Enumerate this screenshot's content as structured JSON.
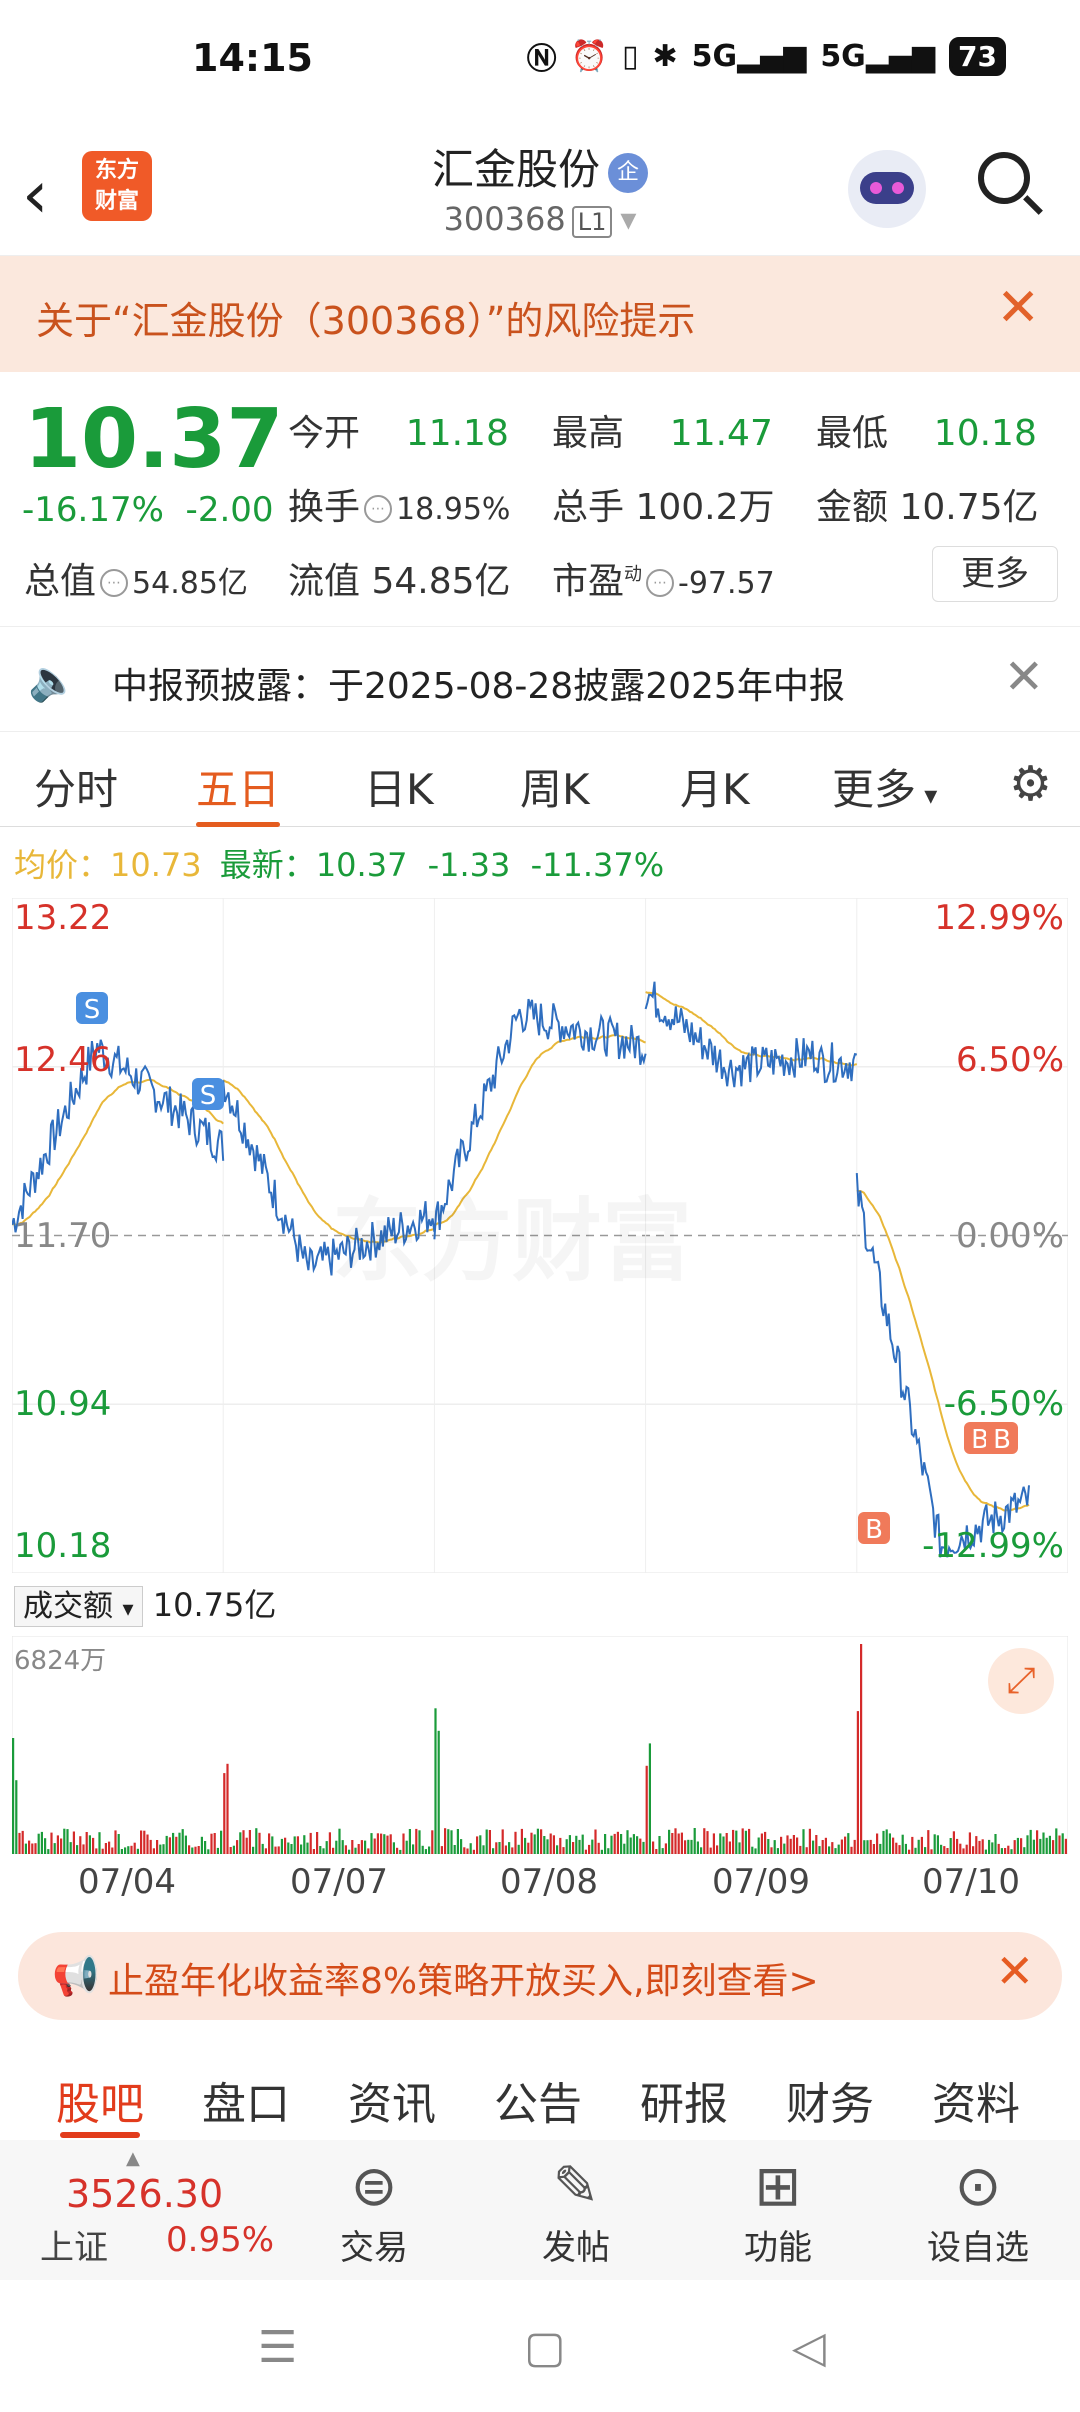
{
  "status_bar": {
    "time": "14:15",
    "network": "5G",
    "battery": "73"
  },
  "header": {
    "stock_name": "汇金股份",
    "stock_code": "300368",
    "level_badge": "L1",
    "qualified_badge": "企",
    "logo_line1": "东方",
    "logo_line2": "财富"
  },
  "risk_banner": {
    "text": "关于“汇金股份（300368）”的风险提示"
  },
  "quote": {
    "price": "10.37",
    "change_pct": "-16.17%",
    "change": "-2.00",
    "open_label": "今开",
    "open": "11.18",
    "high_label": "最高",
    "high": "11.47",
    "low_label": "最低",
    "low": "10.18",
    "turnover_label": "换手",
    "turnover": "18.95%",
    "volume_label": "总手",
    "volume": "100.2万",
    "amount_label": "金额",
    "amount": "10.75亿",
    "total_cap_label": "总值",
    "total_cap": "54.85亿",
    "float_cap_label": "流值",
    "float_cap": "54.85亿",
    "pe_label": "市盈",
    "pe_super": "动",
    "pe": "-97.57",
    "more_label": "更多"
  },
  "notice": {
    "text": "中报预披露：于2025-08-28披露2025年中报"
  },
  "chart_tabs": [
    "分时",
    "五日",
    "日K",
    "周K",
    "月K",
    "更多"
  ],
  "active_tab": "五日",
  "avg_line": {
    "avg_label": "均价：",
    "avg": "10.73",
    "latest_label": "最新：",
    "latest": "10.37",
    "latest_change": "-1.33",
    "latest_pct": "-11.37%"
  },
  "chart_data": {
    "type": "line",
    "y_labels_left": [
      "13.22",
      "12.46",
      "11.70",
      "10.94",
      "10.18"
    ],
    "y_labels_right": [
      "12.99%",
      "6.50%",
      "0.00%",
      "-6.50%",
      "-12.99%"
    ],
    "ylim": [
      10.18,
      13.22
    ],
    "x_labels": [
      "07/04",
      "07/07",
      "07/08",
      "07/09",
      "07/10"
    ],
    "volume_axis_max": "6824万",
    "volume_label": "成交额",
    "volume_value": "10.75亿",
    "markers": [
      "S",
      "S",
      "B",
      "B",
      "B"
    ],
    "watermark": "东方财富",
    "colors": {
      "price": "#2f6ebf",
      "avg": "#e8b739",
      "up": "#d42a2a",
      "down": "#1a9b3a"
    }
  },
  "promo": {
    "text": "止盈年化收益率8%策略开放买入,即刻查看>"
  },
  "bottom_tabs": [
    "股吧",
    "盘口",
    "资讯",
    "公告",
    "研报",
    "财务",
    "资料"
  ],
  "footer": {
    "index_value": "3526.30",
    "index_name": "上证",
    "index_pct": "0.95%",
    "buttons": [
      "交易",
      "发帖",
      "功能",
      "设自选"
    ]
  }
}
